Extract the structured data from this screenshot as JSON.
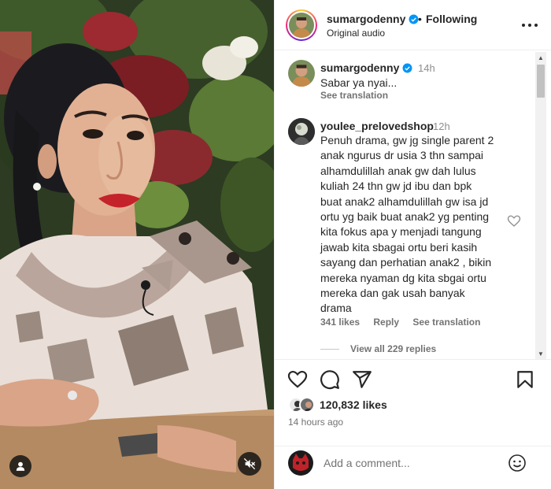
{
  "post": {
    "username": "sumargodenny",
    "separator": "•",
    "follow_status": "Following",
    "audio": "Original audio"
  },
  "caption": {
    "username": "sumargodenny",
    "time": "14h",
    "text": "Sabar ya nyai...",
    "translate": "See translation"
  },
  "comment": {
    "username": "youlee_prelovedshop",
    "time": "12h",
    "lines": [
      "Penuh drama, gw jg single parent 2",
      "anak ngurus dr usia 3 thn sampai",
      "alhamdulillah anak gw dah lulus",
      "kuliah 24 thn gw jd ibu dan bpk",
      "buat anak2 alhamdulillah gw isa jd",
      "ortu yg baik buat anak2 yg penting",
      "kita fokus apa y menjadi tangung",
      "jawab kita sbagai ortu beri kasih",
      "sayang dan perhatian anak2 , bikin",
      "mereka nyaman dg kita sbgai ortu",
      "mereka dan gak usah banyak",
      "drama"
    ],
    "likes": "341 likes",
    "reply": "Reply",
    "translate": "See translation",
    "view_replies": "View all 229 replies"
  },
  "engagement": {
    "likes_count": "120,832",
    "likes_word": "likes",
    "posted": "14 hours ago"
  },
  "composer": {
    "placeholder": "Add a comment..."
  },
  "icons": {
    "like": "heart-icon",
    "comment": "comment-icon",
    "share": "send-icon",
    "save": "bookmark-icon",
    "more": "more-options-icon",
    "emoji": "emoji-icon",
    "verified": "verified-badge-icon",
    "mute": "muted-speaker-icon",
    "tag": "user-tag-icon"
  },
  "colors": {
    "verified_blue": "#0095f6",
    "text_primary": "#262626",
    "text_secondary": "#737373",
    "divider": "#efefef"
  }
}
